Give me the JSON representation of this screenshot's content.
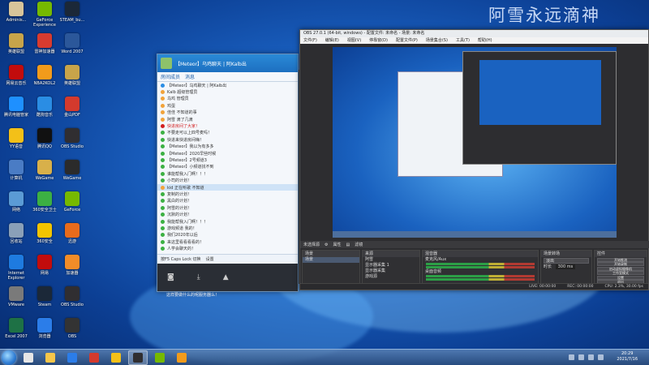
{
  "watermark": "阿雪永远滴神",
  "desktop": {
    "icons": [
      {
        "label": "Adminis...",
        "color": "#d8c49a"
      },
      {
        "label": "GeForce Experience",
        "color": "#76b900"
      },
      {
        "label": "STEAM_bu...",
        "color": "#1b2838"
      },
      {
        "label": "英雄联盟",
        "color": "#c7a44a"
      },
      {
        "label": "雷神加速器",
        "color": "#d83b2f"
      },
      {
        "label": "Word 2007",
        "color": "#2b579a"
      },
      {
        "label": "网易云音乐",
        "color": "#c20c0c"
      },
      {
        "label": "NBA2KOL2",
        "color": "#f29b1b"
      },
      {
        "label": "英雄联盟",
        "color": "#c7a44a"
      },
      {
        "label": "腾讯电脑管家",
        "color": "#1e90ff"
      },
      {
        "label": "酷狗音乐",
        "color": "#2a8de4"
      },
      {
        "label": "金山PDF",
        "color": "#d43a2d"
      },
      {
        "label": "YY语音",
        "color": "#f3c018"
      },
      {
        "label": "腾讯QQ",
        "color": "#111111"
      },
      {
        "label": "OBS Studio",
        "color": "#302e31"
      },
      {
        "label": "计算机",
        "color": "#4a7cc5"
      },
      {
        "label": "WeGame",
        "color": "#d8b04a"
      },
      {
        "label": "WeGame",
        "color": "#2b2b2b"
      },
      {
        "label": "网络",
        "color": "#5b9bd5"
      },
      {
        "label": "360安全卫士",
        "color": "#3cb043"
      },
      {
        "label": "GeForce",
        "color": "#76b900"
      },
      {
        "label": "回收站",
        "color": "#8aa0b8"
      },
      {
        "label": "360安全",
        "color": "#f2c400"
      },
      {
        "label": "迅游",
        "color": "#e86b1c"
      },
      {
        "label": "Internet Explorer",
        "color": "#1e7be0"
      },
      {
        "label": "网易",
        "color": "#c20c0c"
      },
      {
        "label": "加速器",
        "color": "#f28c28"
      },
      {
        "label": "VMware",
        "color": "#7a7a7a"
      },
      {
        "label": "Steam",
        "color": "#1b2838"
      },
      {
        "label": "OBS Studio",
        "color": "#302e31"
      },
      {
        "label": "Excel 2007",
        "color": "#1e7145"
      },
      {
        "label": "浏览器",
        "color": "#2b7de9"
      },
      {
        "label": "OBS",
        "color": "#333333"
      }
    ]
  },
  "chat": {
    "title": "【Meteor】乌鸡聊天 | 阿Kalb出",
    "tabs": [
      "房间成员",
      "消息"
    ],
    "members": [
      {
        "text": "【Meteor】乌鸡聊天 | 阿Kalb出",
        "hl": false,
        "color": "#2a8de4"
      },
      {
        "text": "Kalb 超级管理员",
        "hl": false,
        "color": "#f2a33a"
      },
      {
        "text": "乌鸡 管理员",
        "hl": false,
        "color": "#f2a33a"
      },
      {
        "text": "鸡蛋",
        "hl": false,
        "color": "#f2a33a"
      },
      {
        "text": "佳佳 不知道的事",
        "hl": false,
        "color": "#f2a33a"
      },
      {
        "text": "阿雪 滴了几滴",
        "hl": false,
        "color": "#f2a33a"
      },
      {
        "text": "快进房间了大家！",
        "hl": true,
        "color": "#d21f1f"
      },
      {
        "text": "不要走可以上四号麦吗！",
        "hl": false,
        "color": "#3cb043"
      },
      {
        "text": "快进来快进房间嗨！",
        "hl": false,
        "color": "#3cb043"
      },
      {
        "text": "【Meteor】我以为有多多",
        "hl": false,
        "color": "#3cb043"
      },
      {
        "text": "【Meteor】2020早些时候",
        "hl": false,
        "color": "#3cb043"
      },
      {
        "text": "【Meteor】2号频道3",
        "hl": false,
        "color": "#3cb043"
      },
      {
        "text": "【Meteor】小频道找不到",
        "hl": false,
        "color": "#3cb043"
      },
      {
        "text": "谁能帮我入门啊！！！",
        "hl": false,
        "color": "#3cb043"
      },
      {
        "text": "小司的计划！",
        "hl": false,
        "color": "#3cb043"
      },
      {
        "text": "kid 正在听歌 不知道",
        "hl": false,
        "color": "#f2a33a",
        "sel": true
      },
      {
        "text": "复制的计划！",
        "hl": false,
        "color": "#3cb043"
      },
      {
        "text": "黑白的计划！",
        "hl": false,
        "color": "#3cb043"
      },
      {
        "text": "阿雪的计划！",
        "hl": false,
        "color": "#3cb043"
      },
      {
        "text": "沉默的计划！",
        "hl": false,
        "color": "#3cb043"
      },
      {
        "text": "我能帮我入门啊！！！",
        "hl": false,
        "color": "#3cb043"
      },
      {
        "text": "游戏频道 我的！",
        "hl": false,
        "color": "#3cb043"
      },
      {
        "text": "我们2020年以后",
        "hl": false,
        "color": "#3cb043"
      },
      {
        "text": "来这里看看看看的！",
        "hl": false,
        "color": "#3cb043"
      },
      {
        "text": "人学会聊天的！",
        "hl": false,
        "color": "#3cb043"
      }
    ],
    "tray": [
      "按F5 Caps Lock 切换",
      "设置"
    ],
    "notice": "这样要做什么的呢服务器么！"
  },
  "obs": {
    "title": "OBS 27.0.1 (64-bit, windows) - 配置文件: 未命名 - 场景: 未命名",
    "menu": [
      "文件(F)",
      "编辑(E)",
      "视图(V)",
      "停靠窗(D)",
      "配置文件(P)",
      "场景集合(S)",
      "工具(T)",
      "帮助(H)"
    ],
    "toolrow": [
      "未选择源",
      "属性",
      "滤镜"
    ],
    "scenes": {
      "header": "场景",
      "items": [
        "场景"
      ]
    },
    "sources": {
      "header": "来源",
      "items": [
        "阿雪",
        "显示器采集 1",
        "显示器采集",
        "游戏源"
      ]
    },
    "mixer": {
      "header": "混音器",
      "channels": [
        "麦克风/Aux",
        "桌面音频"
      ]
    },
    "transitions": {
      "header": "场景转场",
      "type": "淡出",
      "duration_label": "时长",
      "duration": "300 ms"
    },
    "controls": {
      "header": "控件",
      "buttons": [
        "开始推流",
        "开始录制",
        "启动虚拟摄像机",
        "工作室模式",
        "设置",
        "退出"
      ]
    },
    "status": [
      "LIVE: 00:00:00",
      "REC: 00:00:00",
      "CPU: 2.3%, 30.00 fps"
    ]
  },
  "taskbar": {
    "clock_time": "20:29",
    "clock_date": "2021/7/16",
    "items": [
      {
        "color": "#e6e6e6",
        "active": false
      },
      {
        "color": "#f6c64a",
        "active": false
      },
      {
        "color": "#2b7de9",
        "active": false
      },
      {
        "color": "#d43a2d",
        "active": false
      },
      {
        "color": "#f3c018",
        "active": false
      },
      {
        "color": "#302e31",
        "active": true
      },
      {
        "color": "#76b900",
        "active": false
      },
      {
        "color": "#f29b1b",
        "active": false
      }
    ]
  }
}
